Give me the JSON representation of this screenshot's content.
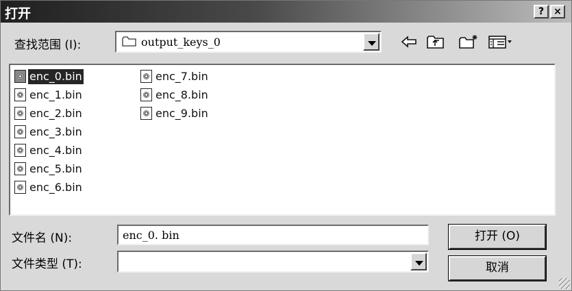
{
  "window": {
    "title": "打开",
    "help_label": "?",
    "close_label": "×"
  },
  "lookin": {
    "label": "查找范围 (I):",
    "value": "output_keys_0"
  },
  "toolbar": {
    "back_icon": "back-arrow-icon",
    "up_icon": "up-folder-icon",
    "new_folder_icon": "new-folder-icon",
    "view_menu_icon": "view-menu-icon"
  },
  "files": [
    {
      "name": "enc_0.bin",
      "selected": true
    },
    {
      "name": "enc_1.bin",
      "selected": false
    },
    {
      "name": "enc_2.bin",
      "selected": false
    },
    {
      "name": "enc_3.bin",
      "selected": false
    },
    {
      "name": "enc_4.bin",
      "selected": false
    },
    {
      "name": "enc_5.bin",
      "selected": false
    },
    {
      "name": "enc_6.bin",
      "selected": false
    },
    {
      "name": "enc_7.bin",
      "selected": false
    },
    {
      "name": "enc_8.bin",
      "selected": false
    },
    {
      "name": "enc_9.bin",
      "selected": false
    }
  ],
  "filename": {
    "label": "文件名 (N):",
    "value": "enc_0. bin"
  },
  "filetype": {
    "label": "文件类型 (T):",
    "value": ""
  },
  "buttons": {
    "open_label": "打开 (O)",
    "cancel_label": "取消"
  }
}
